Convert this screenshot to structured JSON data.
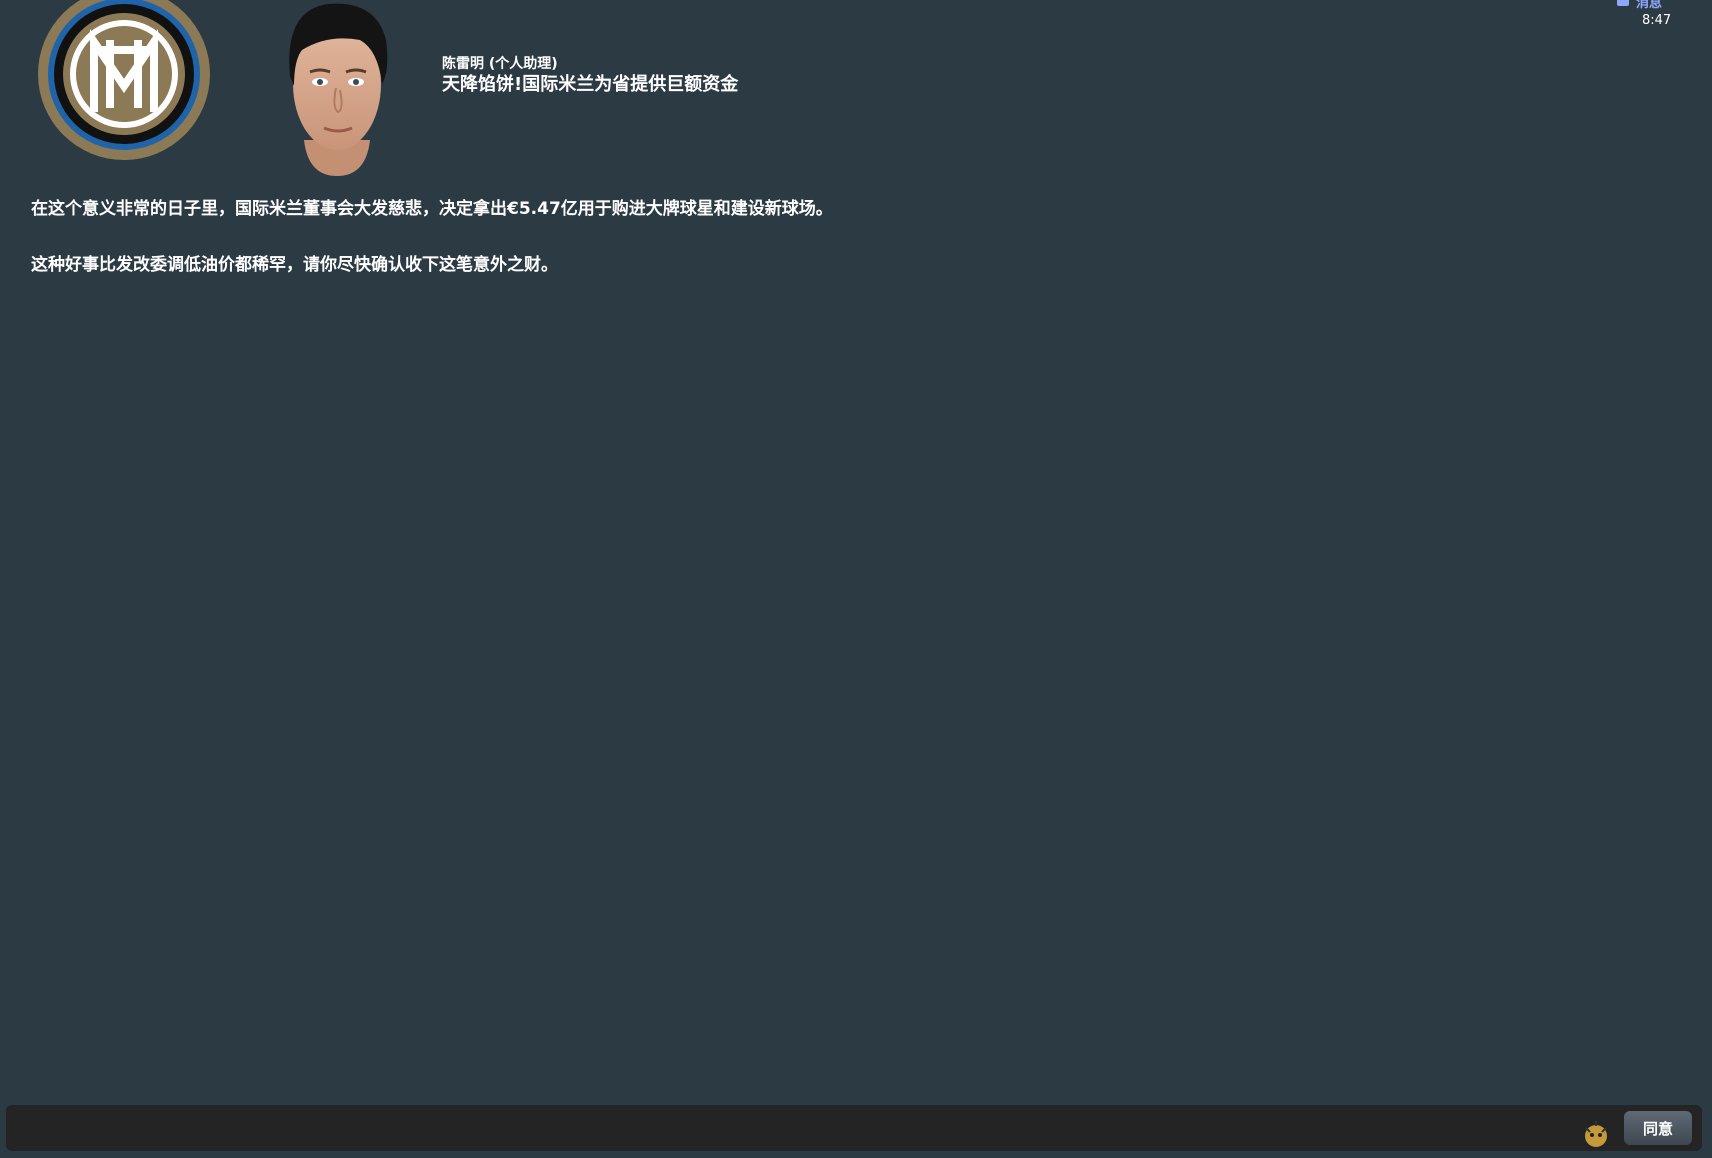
{
  "header": {
    "sender": "陈雷明 (个人助理)",
    "subject": "天降馅饼!国际米兰为省提供巨额资金"
  },
  "corner": {
    "tab_label": "消息",
    "time": "8:47"
  },
  "message": {
    "paragraphs": [
      "在这个意义非常的日子里，国际米兰董事会大发慈悲，决定拿出€5.47亿用于购进大牌球星和建设新球场。",
      "这种好事比发改委调低油价都稀罕，请你尽快确认收下这笔意外之财。"
    ]
  },
  "footer": {
    "agree_label": "同意"
  },
  "icons": {
    "crest": "inter-milan-crest-icon",
    "portrait": "assistant-portrait-icon",
    "tab": "message-icon",
    "watermark": "watermark-mascot-icon"
  },
  "colors": {
    "background": "#2c3a44",
    "footer": "#242424",
    "crest_blue": "#1f63a8",
    "crest_gold": "#8c7a57",
    "tab_accent": "#8fa7ff"
  }
}
